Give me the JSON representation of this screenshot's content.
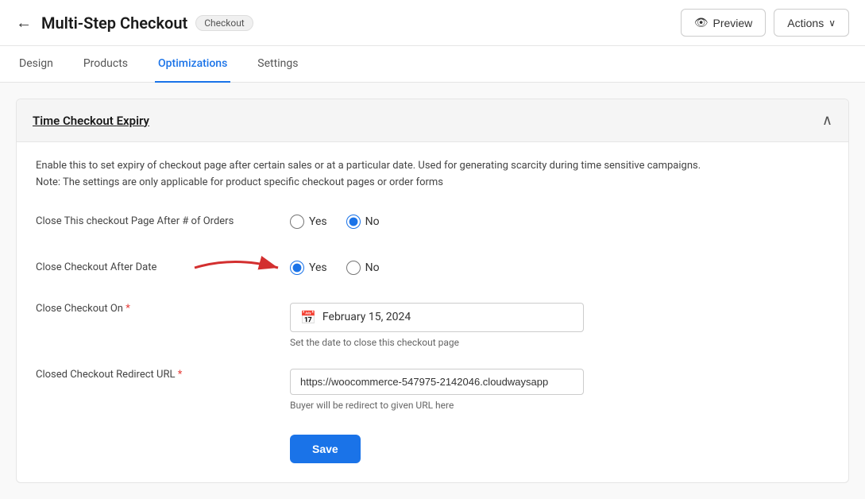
{
  "header": {
    "back_label": "←",
    "title": "Multi-Step Checkout",
    "badge": "Checkout",
    "preview_label": "Preview",
    "actions_label": "Actions",
    "chevron": "∨"
  },
  "tabs": [
    {
      "id": "design",
      "label": "Design",
      "active": false
    },
    {
      "id": "products",
      "label": "Products",
      "active": false
    },
    {
      "id": "optimizations",
      "label": "Optimizations",
      "active": true
    },
    {
      "id": "settings",
      "label": "Settings",
      "active": false
    }
  ],
  "section": {
    "title_start": "Time Checkout ",
    "title_highlight": "Expiry",
    "collapse_icon": "∧",
    "info_line1": "Enable this to set expiry of checkout page after certain sales or at a particular date. Used for generating scarcity during time sensitive campaigns.",
    "info_line2": "Note: The settings are only applicable for product specific checkout pages or order forms"
  },
  "form": {
    "close_orders_label": "Close This checkout Page After # of Orders",
    "close_orders_yes": "Yes",
    "close_orders_no": "No",
    "close_date_label": "Close Checkout After Date",
    "close_date_yes": "Yes",
    "close_date_no": "No",
    "close_on_label": "Close Checkout On",
    "close_on_required": "*",
    "close_on_date": "February 15, 2024",
    "close_on_hint": "Set the date to close this checkout page",
    "redirect_label": "Closed Checkout Redirect URL",
    "redirect_required": "*",
    "redirect_value": "https://woocommerce-547975-2142046.cloudwaysapp",
    "redirect_hint": "Buyer will be redirect to given URL here",
    "save_label": "Save"
  }
}
